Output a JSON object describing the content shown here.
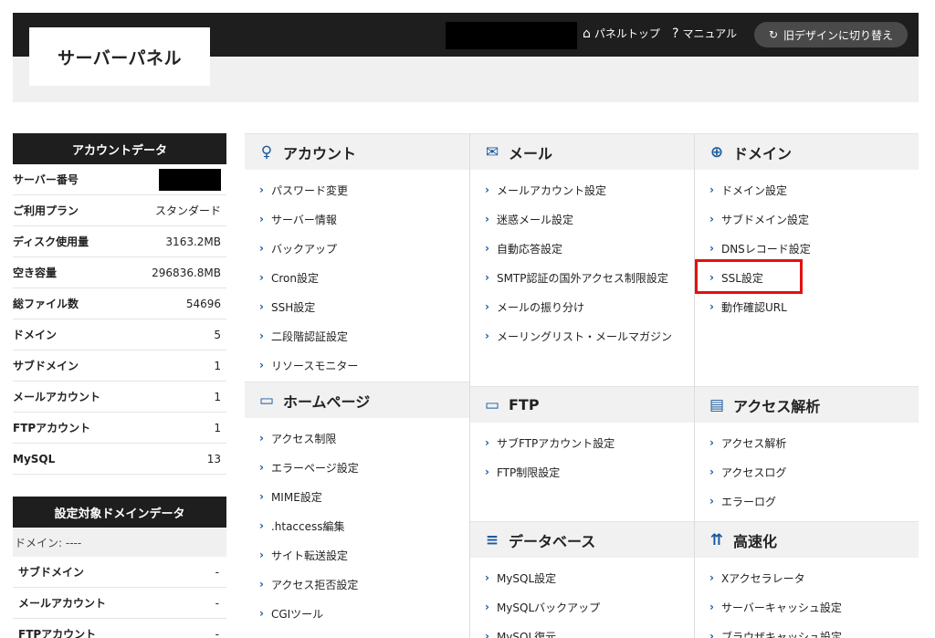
{
  "header": {
    "logo": "サーバーパネル",
    "panel_top": "パネルトップ",
    "manual": "マニュアル",
    "old_design": "旧デザインに切り替え"
  },
  "sidebar": {
    "account_title": "アカウントデータ",
    "account_rows": [
      {
        "label": "サーバー番号",
        "value": ""
      },
      {
        "label": "ご利用プラン",
        "value": "スタンダード"
      },
      {
        "label": "ディスク使用量",
        "value": "3163.2MB"
      },
      {
        "label": "空き容量",
        "value": "296836.8MB"
      },
      {
        "label": "総ファイル数",
        "value": "54696"
      },
      {
        "label": "ドメイン",
        "value": "5"
      },
      {
        "label": "サブドメイン",
        "value": "1"
      },
      {
        "label": "メールアカウント",
        "value": "1"
      },
      {
        "label": "FTPアカウント",
        "value": "1"
      },
      {
        "label": "MySQL",
        "value": "13"
      }
    ],
    "domain_title": "設定対象ドメインデータ",
    "domain_label": "ドメイン: ----",
    "domain_rows": [
      {
        "label": "サブドメイン",
        "value": "-"
      },
      {
        "label": "メールアカウント",
        "value": "-"
      },
      {
        "label": "FTPアカウント",
        "value": "-"
      }
    ]
  },
  "sections": {
    "account": {
      "title": "アカウント",
      "items": [
        "パスワード変更",
        "サーバー情報",
        "バックアップ",
        "Cron設定",
        "SSH設定",
        "二段階認証設定",
        "リソースモニター"
      ]
    },
    "mail": {
      "title": "メール",
      "items": [
        "メールアカウント設定",
        "迷惑メール設定",
        "自動応答設定",
        "SMTP認証の国外アクセス制限設定",
        "メールの振り分け",
        "メーリングリスト・メールマガジン"
      ]
    },
    "domain": {
      "title": "ドメイン",
      "items": [
        "ドメイン設定",
        "サブドメイン設定",
        "DNSレコード設定",
        "SSL設定",
        "動作確認URL"
      ]
    },
    "homepage": {
      "title": "ホームページ",
      "items": [
        "アクセス制限",
        "エラーページ設定",
        "MIME設定",
        ".htaccess編集",
        "サイト転送設定",
        "アクセス拒否設定",
        "CGIツール"
      ]
    },
    "ftp": {
      "title": "FTP",
      "items": [
        "サブFTPアカウント設定",
        "FTP制限設定"
      ]
    },
    "analytics": {
      "title": "アクセス解析",
      "items": [
        "アクセス解析",
        "アクセスログ",
        "エラーログ"
      ]
    },
    "database": {
      "title": "データベース",
      "items": [
        "MySQL設定",
        "MySQLバックアップ",
        "MySQL復元"
      ]
    },
    "speed": {
      "title": "高速化",
      "items": [
        "Xアクセラレータ",
        "サーバーキャッシュ設定",
        "ブラウザキャッシュ設定"
      ]
    }
  }
}
